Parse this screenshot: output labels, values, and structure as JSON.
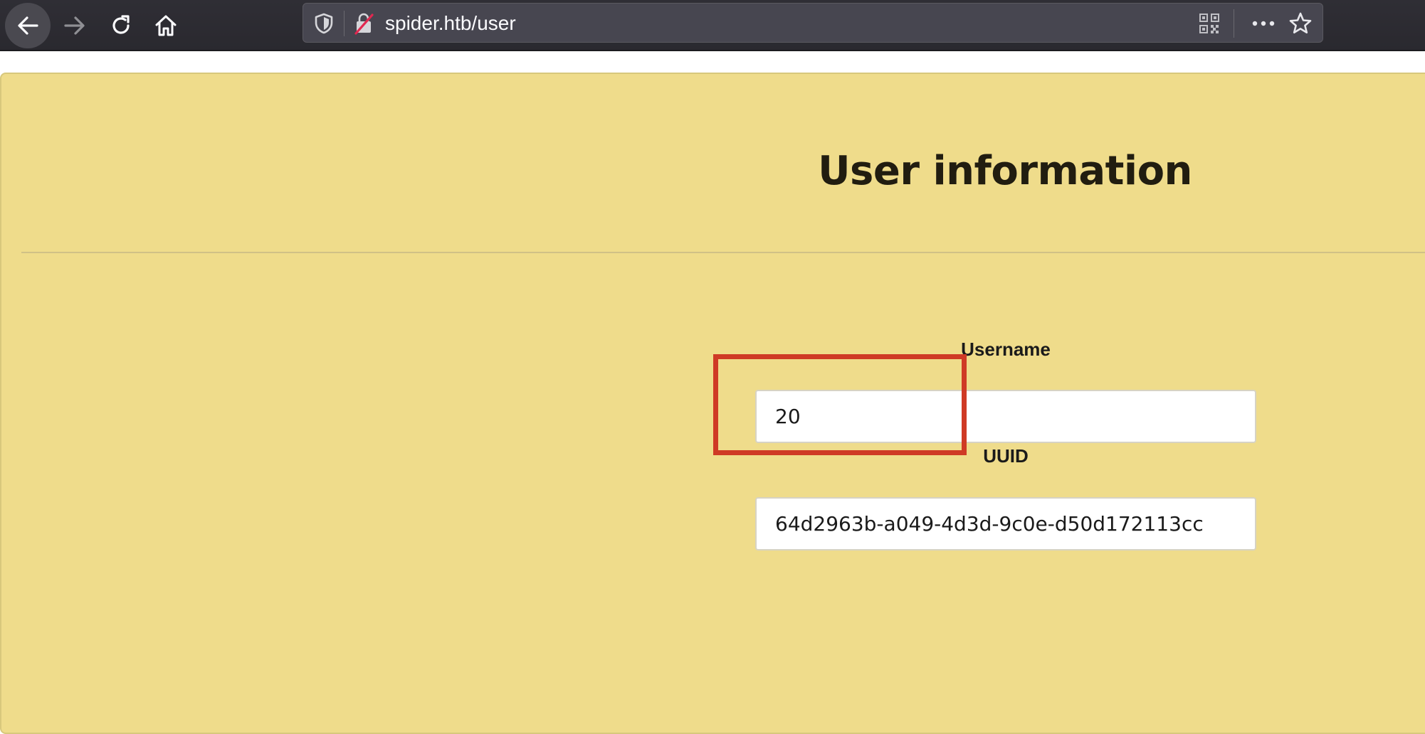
{
  "browser": {
    "url": "spider.htb/user",
    "icons": {
      "back": "arrow-left-icon",
      "forward": "arrow-right-icon",
      "reload": "reload-icon",
      "home": "home-icon",
      "tracking": "shield-icon",
      "insecure": "insecure-lock-icon",
      "qr": "qr-code-icon",
      "more": "more-dots-icon",
      "bookmark": "star-icon"
    }
  },
  "page": {
    "title": "User information",
    "fields": {
      "username": {
        "label": "Username",
        "value": "20"
      },
      "uuid": {
        "label": "UUID",
        "value": "64d2963b-a049-4d3d-9c0e-d50d172113cc"
      }
    }
  },
  "colors": {
    "panel_background": "#efdc8b",
    "highlight": "#cf3a25",
    "toolbar": "#2b2a33"
  }
}
